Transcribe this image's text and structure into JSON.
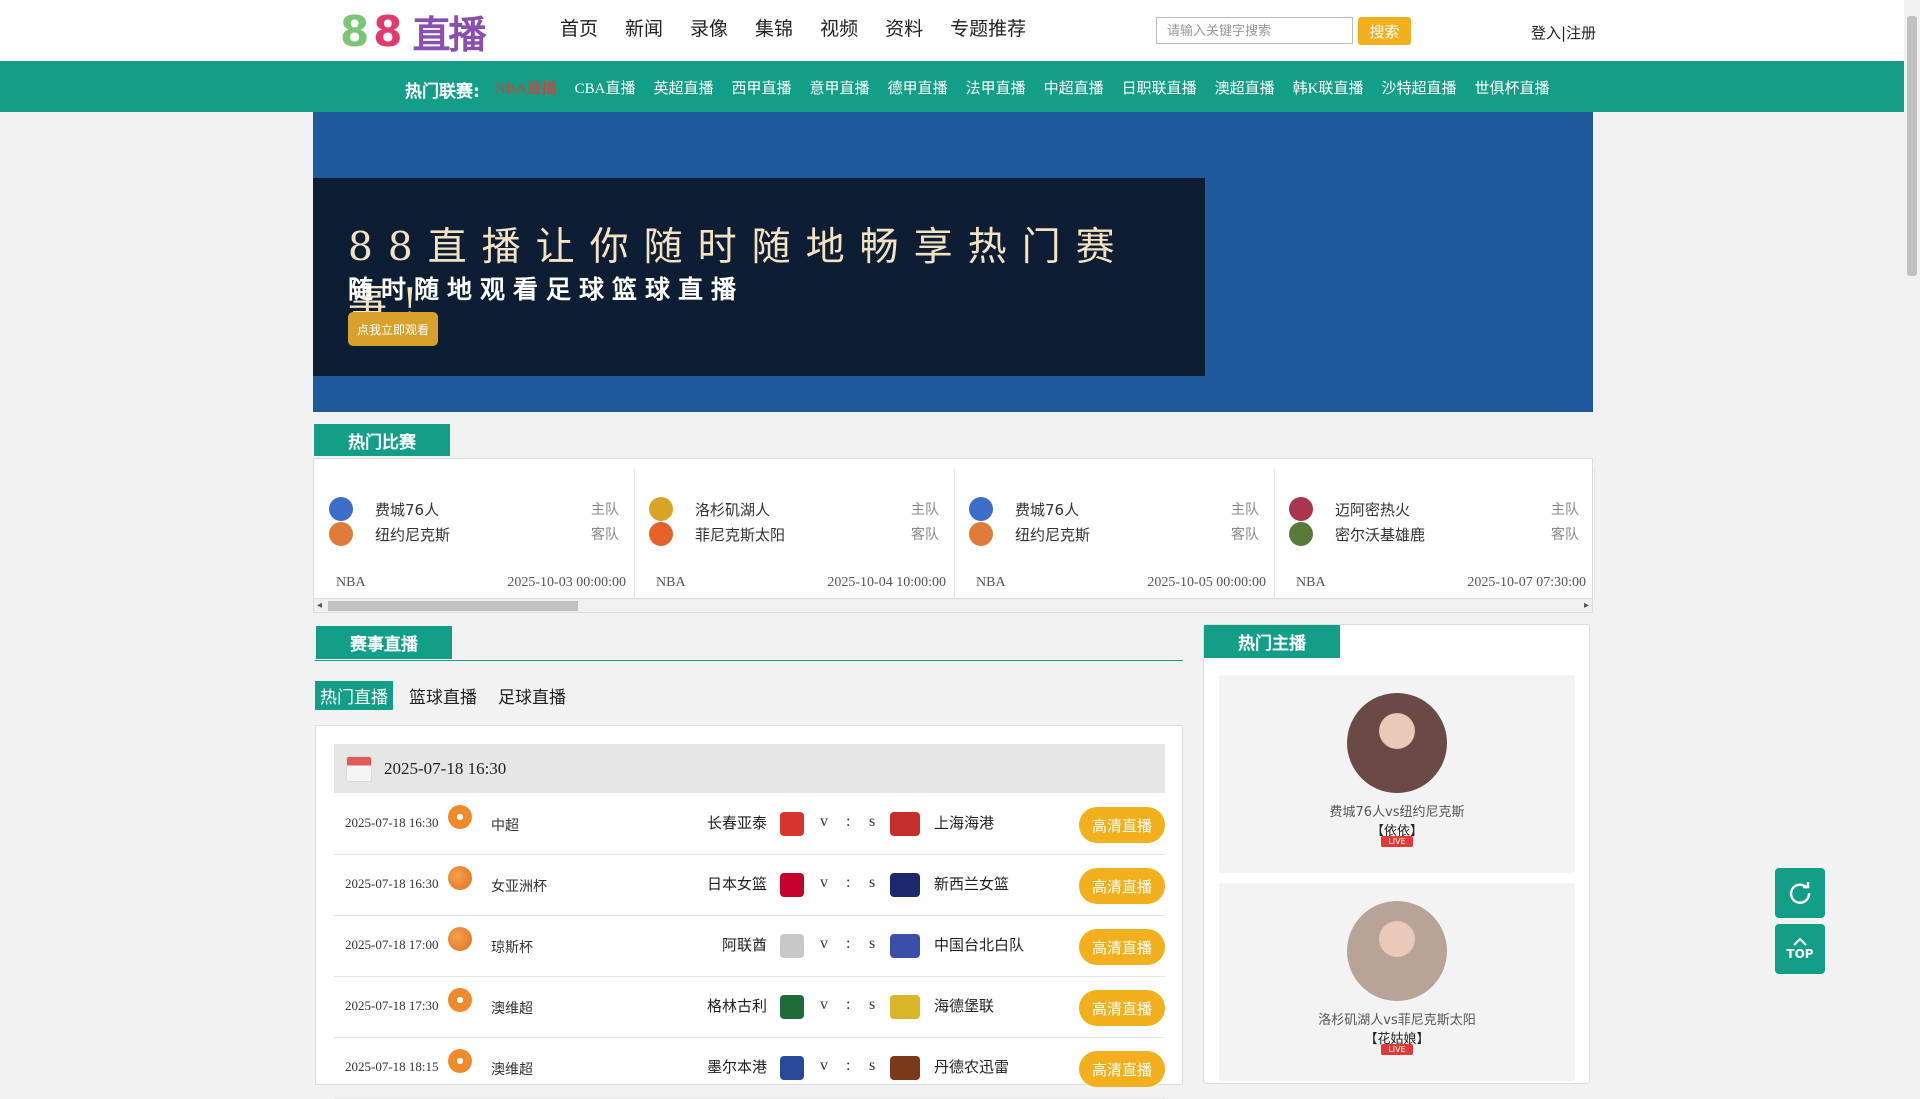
{
  "header": {
    "logo_digits": "88",
    "logo_text": "直播",
    "nav": [
      "首页",
      "新闻",
      "录像",
      "集锦",
      "视频",
      "资料",
      "专题推荐"
    ],
    "search_placeholder": "请输入关键字搜索",
    "search_button": "搜索",
    "login": "登入",
    "separator": "|",
    "register": "注册"
  },
  "league_bar": {
    "label": "热门联赛:",
    "items": [
      "NBA直播",
      "CBA直播",
      "英超直播",
      "西甲直播",
      "意甲直播",
      "德甲直播",
      "法甲直播",
      "中超直播",
      "日职联直播",
      "澳超直播",
      "韩K联直播",
      "沙特超直播",
      "世俱杯直播"
    ],
    "active_index": 0
  },
  "banner": {
    "headline": "88直播让你随时随地畅享热门赛事!",
    "subline": "随时随地观看足球篮球直播",
    "button": "点我立即观看"
  },
  "hot_matches": {
    "title": "热门比赛",
    "home_tag": "主队",
    "away_tag": "客队",
    "cards": [
      {
        "home": "费城76人",
        "away": "纽约尼克斯",
        "league": "NBA",
        "time": "2025-10-03 00:00:00",
        "home_color": "#3b6fc9",
        "away_color": "#e07b39"
      },
      {
        "home": "洛杉矶湖人",
        "away": "菲尼克斯太阳",
        "league": "NBA",
        "time": "2025-10-04 10:00:00",
        "home_color": "#d9a528",
        "away_color": "#e5622a"
      },
      {
        "home": "费城76人",
        "away": "纽约尼克斯",
        "league": "NBA",
        "time": "2025-10-05 00:00:00",
        "home_color": "#3b6fc9",
        "away_color": "#e07b39"
      },
      {
        "home": "迈阿密热火",
        "away": "密尔沃基雄鹿",
        "league": "NBA",
        "time": "2025-10-07 07:30:00",
        "home_color": "#a9354e",
        "away_color": "#5a7a3a"
      }
    ]
  },
  "live": {
    "title": "赛事直播",
    "tabs": [
      "热门直播",
      "篮球直播",
      "足球直播"
    ],
    "active_tab": 0,
    "date_header": "2025-07-18 16:30",
    "v": "v",
    "colon": ":",
    "s": "s",
    "button": "高清直播",
    "rows": [
      {
        "time": "2025-07-18 16:30",
        "sport": "football",
        "league": "中超",
        "home": "长春亚泰",
        "away": "上海海港",
        "home_color": "#d9342b",
        "away_color": "#c7302a"
      },
      {
        "time": "2025-07-18 16:30",
        "sport": "basketball",
        "league": "女亚洲杯",
        "home": "日本女篮",
        "away": "新西兰女篮",
        "home_color": "#c4002c",
        "away_color": "#1a2a6c"
      },
      {
        "time": "2025-07-18 17:00",
        "sport": "basketball",
        "league": "琼斯杯",
        "home": "阿联酋",
        "away": "中国台北白队",
        "home_color": "#c8c8c8",
        "away_color": "#3a4fa8"
      },
      {
        "time": "2025-07-18 17:30",
        "sport": "football",
        "league": "澳维超",
        "home": "格林古利",
        "away": "海德堡联",
        "home_color": "#1f6b3a",
        "away_color": "#d8b628"
      },
      {
        "time": "2025-07-18 18:15",
        "sport": "football",
        "league": "澳维超",
        "home": "墨尔本港",
        "away": "丹德农迅雷",
        "home_color": "#2a4a9c",
        "away_color": "#7a3a1a"
      }
    ]
  },
  "anchors": {
    "title": "热门主播",
    "live_badge": "LIVE",
    "items": [
      {
        "match": "费城76人vs纽约尼克斯",
        "name": "【依依】",
        "avatar_color": "#6b4a45"
      },
      {
        "match": "洛杉矶湖人vs菲尼克斯太阳",
        "name": "【花姑娘】",
        "avatar_color": "#b8a397"
      }
    ]
  },
  "float": {
    "top_label": "TOP"
  },
  "colors": {
    "teal": "#139e88",
    "gold": "#f2b01e",
    "banner_blue": "#1f5b9c",
    "banner_dark": "#0c1d34",
    "active_red": "#e53935"
  }
}
